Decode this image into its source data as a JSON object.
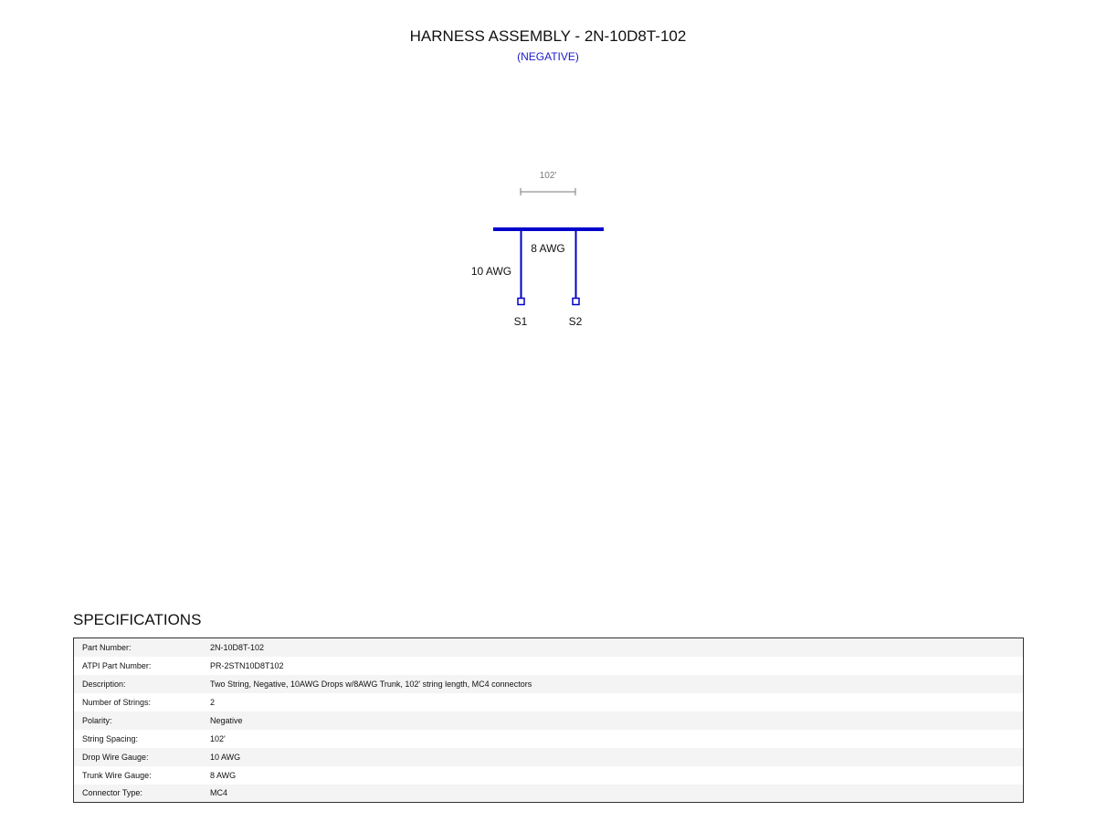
{
  "header": {
    "title": "HARNESS ASSEMBLY - 2N-10D8T-102",
    "subtitle": "(NEGATIVE)"
  },
  "diagram": {
    "spacing_label": "102'",
    "trunk_label": "8 AWG",
    "drop_label": "10 AWG",
    "strings": [
      "S1",
      "S2"
    ],
    "colors": {
      "wire": "#0000cc",
      "dimension": "#777777"
    }
  },
  "specifications": {
    "heading": "SPECIFICATIONS",
    "rows": [
      {
        "label": "Part Number:",
        "value": "2N-10D8T-102"
      },
      {
        "label": "ATPI Part Number:",
        "value": "PR-2STN10D8T102"
      },
      {
        "label": "Description:",
        "value": "Two String, Negative, 10AWG Drops w/8AWG Trunk, 102' string length, MC4 connectors"
      },
      {
        "label": "Number of Strings:",
        "value": "2"
      },
      {
        "label": "Polarity:",
        "value": "Negative"
      },
      {
        "label": "String Spacing:",
        "value": "102'"
      },
      {
        "label": "Drop Wire Gauge:",
        "value": "10 AWG"
      },
      {
        "label": "Trunk Wire Gauge:",
        "value": "8 AWG"
      },
      {
        "label": "Connector Type:",
        "value": "MC4"
      }
    ]
  }
}
